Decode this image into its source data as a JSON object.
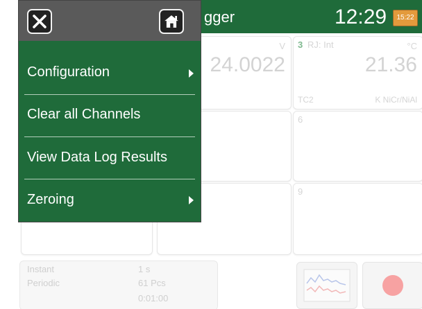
{
  "titlebar": {
    "title_partial": "gger",
    "clock": "12:29",
    "battery_text": "15:22"
  },
  "menu": {
    "close_icon": "close-icon",
    "home_icon": "home-icon",
    "items": [
      {
        "label": "Configuration",
        "has_submenu": true
      },
      {
        "label": "Clear all Channels",
        "has_submenu": false
      },
      {
        "label": "View Data Log Results",
        "has_submenu": false
      },
      {
        "label": "Zeroing",
        "has_submenu": true
      }
    ]
  },
  "channels": {
    "ch2": {
      "unit": "V",
      "value": "24.0022"
    },
    "ch3": {
      "number": "3",
      "label": "RJ: Int",
      "unit": "°C",
      "value": "21.36",
      "sensor": "TC2",
      "type": "K NiCr/NiAl"
    },
    "ch6": {
      "number": "6"
    },
    "ch9": {
      "number": "9"
    }
  },
  "log_settings": {
    "mode1": "Instant",
    "mode2": "Periodic",
    "interval": "1 s",
    "count": "61 Pcs",
    "duration": "0:01:00"
  },
  "colors": {
    "titlebar": "#1f6b3a",
    "menu_bg": "#1f6b3a",
    "menu_header": "#5a5a5a",
    "battery": "#e39a3c",
    "record": "#f7a2a2"
  }
}
